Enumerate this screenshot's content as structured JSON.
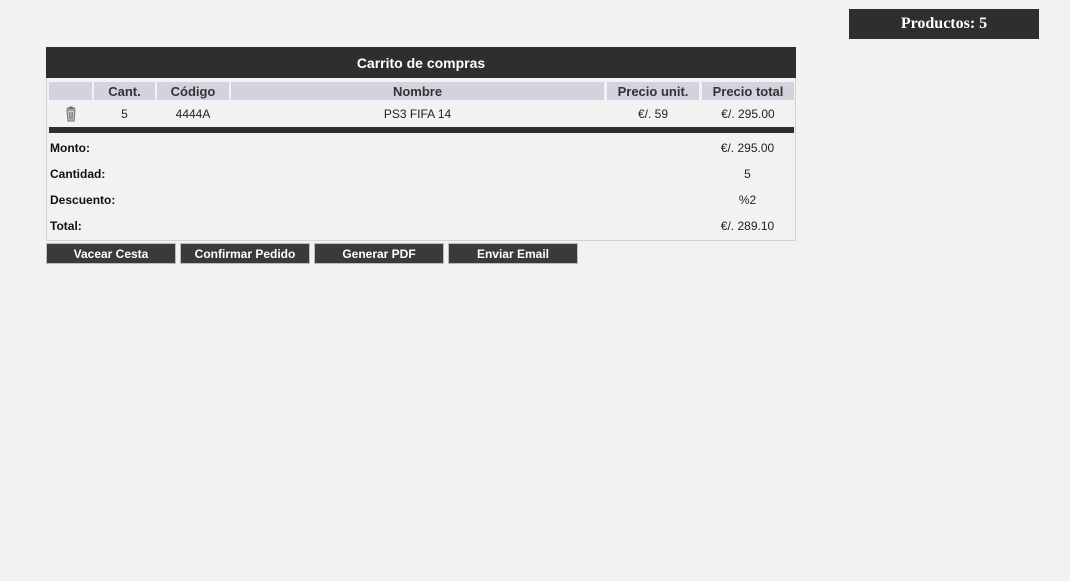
{
  "badge": {
    "label": "Productos: 5"
  },
  "cart": {
    "title": "Carrito de compras",
    "columns": [
      "",
      "Cant.",
      "Código",
      "Nombre",
      "Precio unit.",
      "Precio total"
    ],
    "rows": [
      {
        "icon": "trash-icon",
        "cantidad": "5",
        "codigo": "4444A",
        "nombre": "PS3 FIFA 14",
        "precio_unit": "€/. 59",
        "precio_total": "€/. 295.00"
      }
    ],
    "summary": {
      "monto_label": "Monto:",
      "monto_value": "€/. 295.00",
      "cantidad_label": "Cantidad:",
      "cantidad_value": "5",
      "descuento_label": "Descuento:",
      "descuento_value": "%2",
      "total_label": "Total:",
      "total_value": "€/. 289.10"
    }
  },
  "actions": {
    "vaciar": "Vacear Cesta",
    "confirmar": "Confirmar Pedido",
    "pdf": "Generar PDF",
    "email": "Enviar Email"
  },
  "colors": {
    "background": "#f2f2f2",
    "dark": "#2e2e2e",
    "header": "#d3d3df"
  }
}
